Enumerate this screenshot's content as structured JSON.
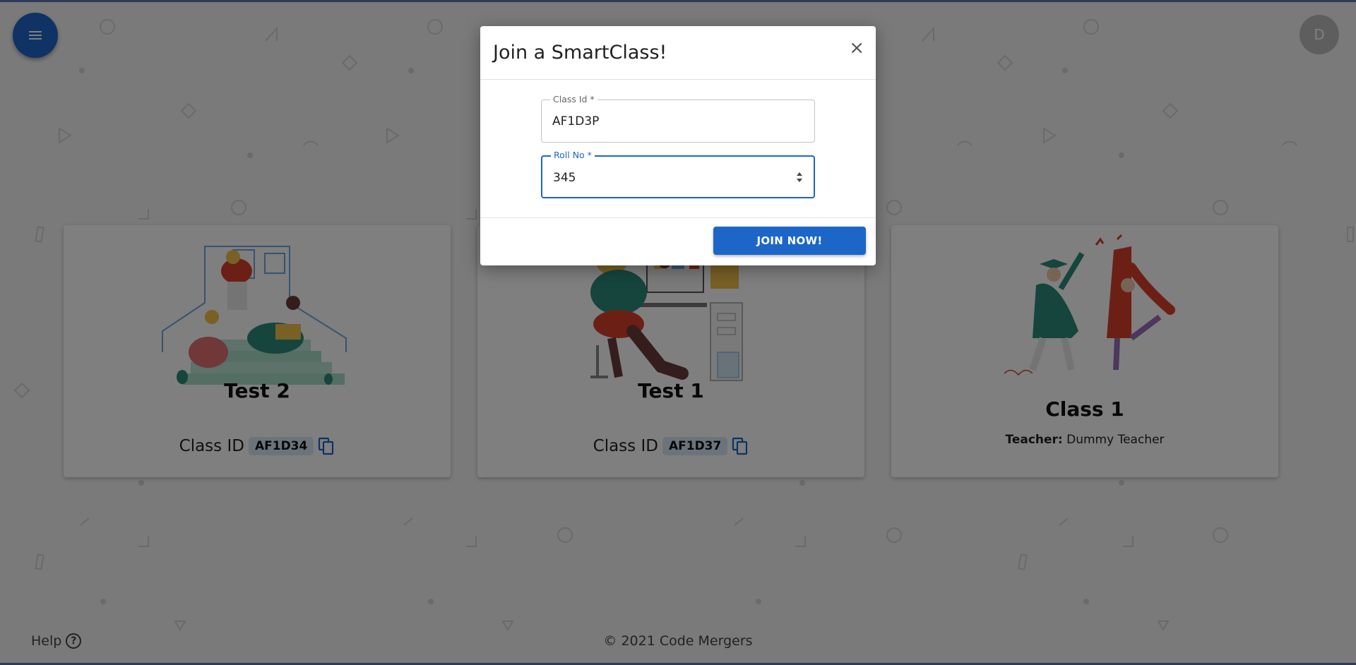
{
  "header": {
    "menu_icon": "menu-icon",
    "avatar_initial": "D"
  },
  "cards": [
    {
      "title": "Test 2",
      "class_id_label": "Class ID",
      "class_id": "AF1D34",
      "illustration": "students-on-stairs"
    },
    {
      "title": "Test 1",
      "class_id_label": "Class ID",
      "class_id": "AF1D37",
      "illustration": "person-at-desk"
    },
    {
      "title": "Class 1",
      "teacher_label": "Teacher:",
      "teacher_name": "Dummy Teacher",
      "illustration": "graduates-celebrating"
    }
  ],
  "footer": {
    "help_label": "Help",
    "copyright": "© 2021 Code Mergers"
  },
  "modal": {
    "title": "Join a SmartClass!",
    "close_symbol": "×",
    "class_id_field": {
      "label": "Class Id *",
      "value": "AF1D3P"
    },
    "roll_no_field": {
      "label": "Roll No *",
      "value": "345"
    },
    "join_button": "JOIN NOW!"
  },
  "colors": {
    "primary": "#1c66c8",
    "chip_bg": "#d9e8f7",
    "avatar_bg": "#bdbdbd"
  }
}
